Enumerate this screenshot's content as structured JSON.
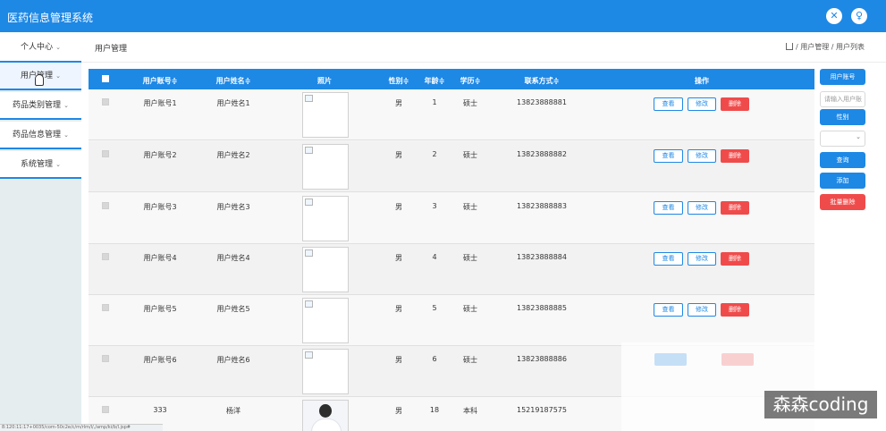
{
  "app": {
    "title": "医药信息管理系统"
  },
  "topbar": {
    "tools": [
      {
        "name": "close-circle-icon",
        "glyph": "✕"
      },
      {
        "name": "user-circle-icon",
        "glyph": "♀"
      }
    ]
  },
  "nav": {
    "top_item": "个人中心",
    "items": [
      "用户管理",
      "药品类别管理",
      "药品信息管理",
      "系统管理"
    ]
  },
  "page": {
    "title": "用户管理",
    "breadcrumb": "/ 用户管理 / 用户列表"
  },
  "table": {
    "headers": [
      "用户账号≑",
      "用户姓名≑",
      "照片",
      "性别≑",
      "年龄≑",
      "学历≑",
      "联系方式≑",
      "操作"
    ],
    "actions": {
      "view": "查看",
      "edit": "修改",
      "delete": "删除"
    },
    "rows": [
      {
        "account": "用户账号1",
        "name": "用户姓名1",
        "gender": "男",
        "age": "1",
        "education": "硕士",
        "phone": "13823888881"
      },
      {
        "account": "用户账号2",
        "name": "用户姓名2",
        "gender": "男",
        "age": "2",
        "education": "硕士",
        "phone": "13823888882"
      },
      {
        "account": "用户账号3",
        "name": "用户姓名3",
        "gender": "男",
        "age": "3",
        "education": "硕士",
        "phone": "13823888883"
      },
      {
        "account": "用户账号4",
        "name": "用户姓名4",
        "gender": "男",
        "age": "4",
        "education": "硕士",
        "phone": "13823888884"
      },
      {
        "account": "用户账号5",
        "name": "用户姓名5",
        "gender": "男",
        "age": "5",
        "education": "硕士",
        "phone": "13823888885"
      },
      {
        "account": "用户账号6",
        "name": "用户姓名6",
        "gender": "男",
        "age": "6",
        "education": "硕士",
        "phone": "13823888886"
      },
      {
        "account": "333",
        "name": "杨洋",
        "gender": "男",
        "age": "18",
        "education": "本科",
        "phone": "15219187575"
      }
    ]
  },
  "filters": {
    "account_label": "用户账号",
    "account_placeholder": "请输入用户账号",
    "gender_label": "性别",
    "query": "查询",
    "add": "添加",
    "batch_delete": "批量删除"
  },
  "watermark": "森森coding",
  "status_url": "8:120:11:17+0035/com-50c2e/c/m/rlm/l/,/amp/ki/b/l.jsp#"
}
